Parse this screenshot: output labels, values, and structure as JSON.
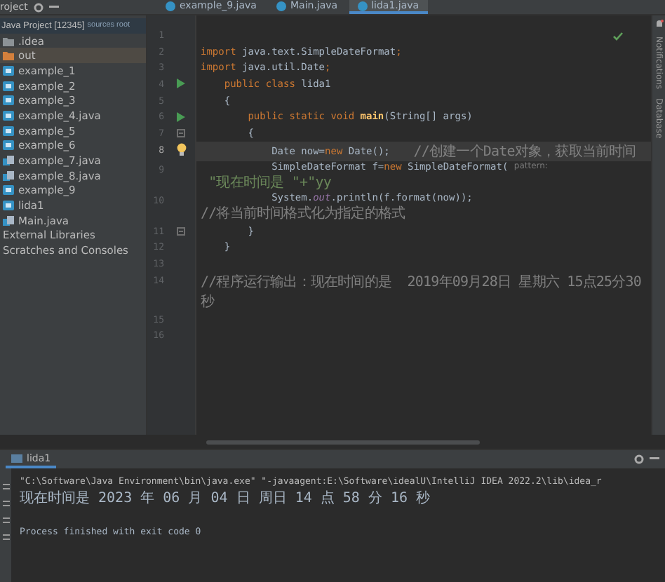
{
  "toolbar": {
    "title": "roject"
  },
  "tabs": [
    {
      "label": "example_9.java",
      "selected": false
    },
    {
      "label": "Main.java",
      "selected": false
    },
    {
      "label": "lida1.java",
      "selected": true
    }
  ],
  "project": {
    "root": "Java Project [12345]",
    "root_note": "sources root",
    "items": [
      {
        "label": ".idea",
        "kind": "folder",
        "selected": false
      },
      {
        "label": "out",
        "kind": "excluded-folder",
        "selected": true
      },
      {
        "label": "example_1",
        "kind": "module",
        "selected": false
      },
      {
        "label": "example_2",
        "kind": "module",
        "selected": false
      },
      {
        "label": "example_3",
        "kind": "module",
        "selected": false
      },
      {
        "label": "example_4.java",
        "kind": "module",
        "selected": false
      },
      {
        "label": "example_5",
        "kind": "module",
        "selected": false
      },
      {
        "label": "example_6",
        "kind": "module",
        "selected": false
      },
      {
        "label": "example_7.java",
        "kind": "file",
        "selected": false
      },
      {
        "label": "example_8.java",
        "kind": "file",
        "selected": false
      },
      {
        "label": "example_9",
        "kind": "module",
        "selected": false
      },
      {
        "label": "lida1",
        "kind": "module",
        "selected": false
      },
      {
        "label": "Main.java",
        "kind": "file",
        "selected": false
      },
      {
        "label": "External Libraries",
        "kind": "plain",
        "selected": false
      },
      {
        "label": "Scratches and Consoles",
        "kind": "plain",
        "selected": false
      }
    ]
  },
  "editor": {
    "lines": [
      {
        "number": "1",
        "current": false,
        "kind": "plain"
      },
      {
        "number": "2",
        "current": false,
        "kind": "plain",
        "tokens": [
          {
            "kind": "kw",
            "text": "import"
          },
          {
            "kind": "plain",
            "text": " java.text.SimpleDateFormat"
          },
          {
            "kind": "kw",
            "text": ";"
          }
        ]
      },
      {
        "number": "3",
        "current": false,
        "kind": "plain",
        "tokens": [
          {
            "kind": "kw",
            "text": "import"
          },
          {
            "kind": "plain",
            "text": " java.util.Date"
          },
          {
            "kind": "kw",
            "text": ";"
          }
        ]
      },
      {
        "number": "4",
        "current": false,
        "kind": "run",
        "tokens": [
          {
            "kind": "kw",
            "text": "    public class"
          },
          {
            "kind": "plain",
            "text": " lida1"
          }
        ]
      },
      {
        "number": "5",
        "current": false,
        "kind": "plain",
        "tokens": [
          {
            "kind": "plain",
            "text": "    {"
          }
        ]
      },
      {
        "number": "6",
        "current": false,
        "kind": "run",
        "tokens": [
          {
            "kind": "kw",
            "text": "        public static void"
          },
          {
            "kind": "fn",
            "text": " main"
          },
          {
            "kind": "plain",
            "text": "(String[] args)"
          }
        ]
      },
      {
        "number": "7",
        "current": false,
        "kind": "fold",
        "tokens": [
          {
            "kind": "plain",
            "text": "        {"
          }
        ]
      },
      {
        "number": "8",
        "current": true,
        "kind": "bulb",
        "tokens": [
          {
            "kind": "plain",
            "text": "            Date now="
          },
          {
            "kind": "kw",
            "text": "new"
          },
          {
            "kind": "plain",
            "text": " Date();    "
          },
          {
            "kind": "comment",
            "text": "//创建一个Date对象，获取当前时间"
          }
        ]
      },
      {
        "number": "9",
        "current": false,
        "kind": "plain",
        "tokens": [
          {
            "kind": "plain",
            "text": "            SimpleDateFormat f="
          },
          {
            "kind": "kw",
            "text": "new"
          },
          {
            "kind": "plain",
            "text": " SimpleDateFormat( "
          },
          {
            "kind": "hint",
            "text": "pattern:"
          },
          {
            "kind": "string",
            "text": " \"现在时间是 \"+\"yy"
          }
        ]
      },
      {
        "number": "10",
        "current": false,
        "kind": "plain",
        "tokens": [
          {
            "kind": "plain",
            "text": "            System."
          },
          {
            "kind": "field",
            "text": "out"
          },
          {
            "kind": "plain",
            "text": ".println(f.format(now));    "
          },
          {
            "kind": "comment",
            "text": "//将当前时间格式化为指定的格式"
          }
        ]
      },
      {
        "number": "11",
        "current": false,
        "kind": "fold",
        "tokens": [
          {
            "kind": "plain",
            "text": "        }"
          }
        ]
      },
      {
        "number": "12",
        "current": false,
        "kind": "plain",
        "tokens": [
          {
            "kind": "plain",
            "text": "    }"
          }
        ]
      },
      {
        "number": "13",
        "current": false,
        "kind": "plain"
      },
      {
        "number": "14",
        "current": false,
        "kind": "plain",
        "tokens": [
          {
            "kind": "comment",
            "text": "//程序运行输出：现在时间的是  2019年09月28日 星期六 15点25分30秒"
          }
        ]
      },
      {
        "number": "15",
        "current": false,
        "kind": "plain"
      },
      {
        "number": "16",
        "current": false,
        "kind": "plain"
      }
    ]
  },
  "right_strip": [
    "Notifications",
    "Database"
  ],
  "run": {
    "tab": "lida1",
    "output": [
      {
        "kind": "command",
        "text": "\"C:\\Software\\Java Environment\\bin\\java.exe\" \"-javaagent:E:\\Software\\idealU\\IntelliJ IDEA 2022.2\\lib\\idea_r"
      },
      {
        "kind": "output",
        "text": "现在时间是 2023 年 06 月 04 日 周日 14 点 58 分 16 秒"
      },
      {
        "kind": "blank"
      },
      {
        "kind": "output",
        "text": "Process finished with exit code 0"
      }
    ]
  }
}
